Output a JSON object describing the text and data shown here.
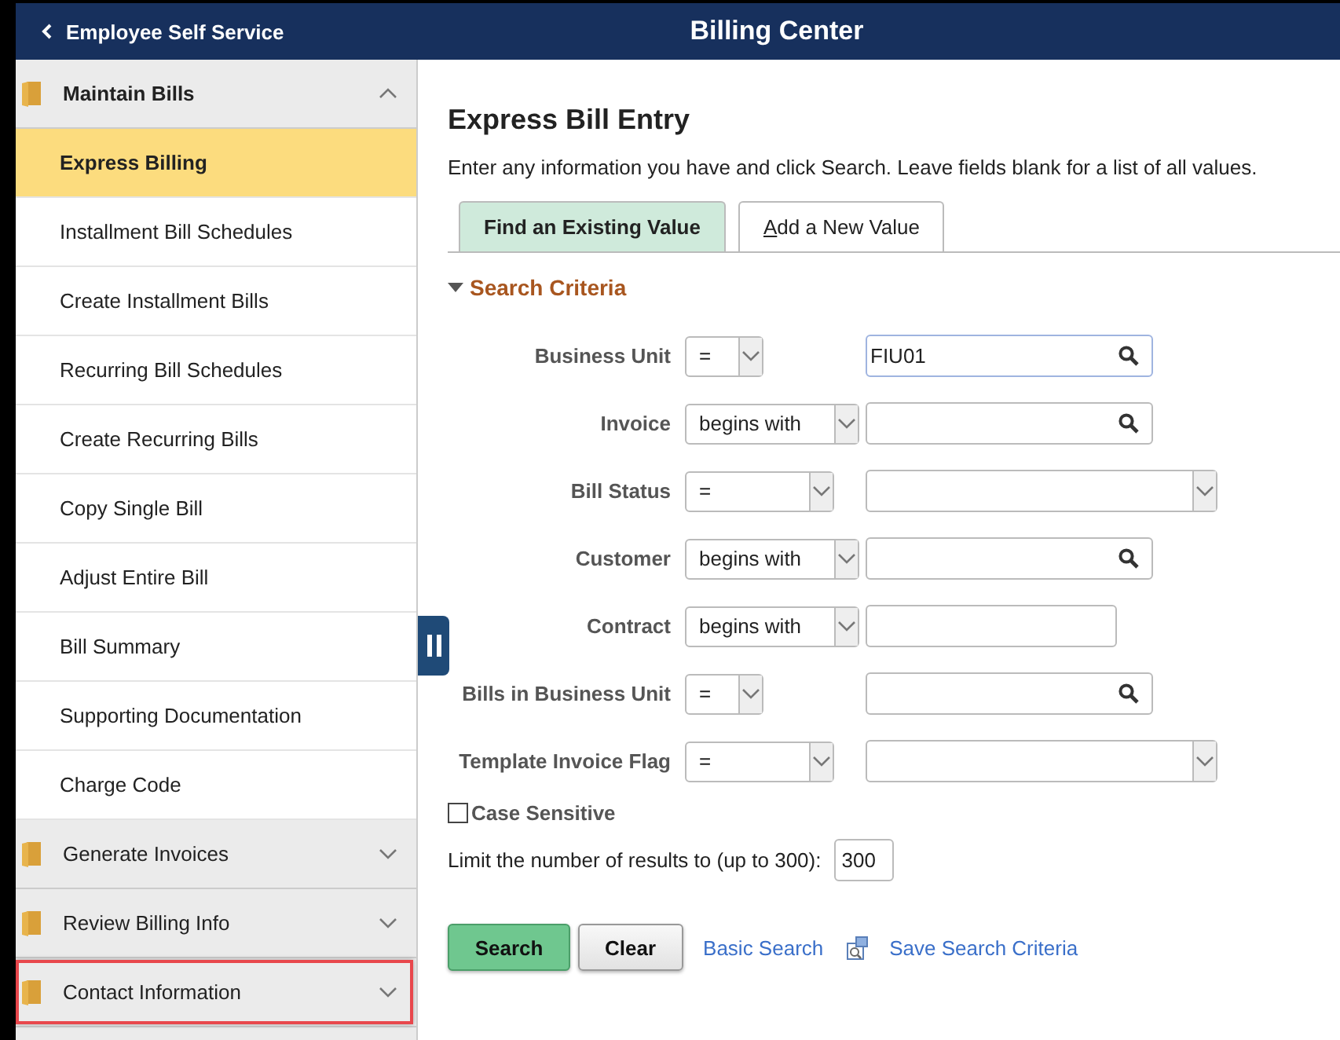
{
  "header": {
    "back_label": "Employee Self Service",
    "title": "Billing Center"
  },
  "sidebar": {
    "groups": [
      {
        "label": "Maintain Bills",
        "expanded": true,
        "highlighted": false,
        "items": [
          {
            "label": "Express Billing",
            "selected": true
          },
          {
            "label": "Installment Bill Schedules",
            "selected": false
          },
          {
            "label": "Create Installment Bills",
            "selected": false
          },
          {
            "label": "Recurring Bill Schedules",
            "selected": false
          },
          {
            "label": "Create Recurring Bills",
            "selected": false
          },
          {
            "label": "Copy Single Bill",
            "selected": false
          },
          {
            "label": "Adjust Entire Bill",
            "selected": false
          },
          {
            "label": "Bill Summary",
            "selected": false
          },
          {
            "label": "Supporting Documentation",
            "selected": false
          },
          {
            "label": "Charge Code",
            "selected": false
          }
        ]
      },
      {
        "label": "Generate Invoices",
        "expanded": false,
        "highlighted": false
      },
      {
        "label": "Review Billing Info",
        "expanded": false,
        "highlighted": false
      },
      {
        "label": "Contact Information",
        "expanded": false,
        "highlighted": true
      }
    ]
  },
  "page": {
    "title": "Express Bill Entry",
    "instructions": "Enter any information you have and click Search. Leave fields blank for a list of all values.",
    "tabs": [
      {
        "label": "Find an Existing Value",
        "selected": true,
        "access_key": false
      },
      {
        "label": "Add a New Value",
        "selected": false,
        "access_key": true
      }
    ],
    "section": {
      "label": "Search Criteria",
      "expanded": true
    },
    "criteria": [
      {
        "label": "Business Unit",
        "operator": "=",
        "kind": "lookup",
        "value": "FIU01",
        "focused": true
      },
      {
        "label": "Invoice",
        "operator": "begins with",
        "kind": "lookup",
        "focused": false
      },
      {
        "label": "Bill Status",
        "operator": "=",
        "kind": "select",
        "focused": false
      },
      {
        "label": "Customer",
        "operator": "begins with",
        "kind": "lookup",
        "focused": false
      },
      {
        "label": "Contract",
        "operator": "begins with",
        "kind": "text",
        "focused": false
      },
      {
        "label": "Bills in Business Unit",
        "operator": "=",
        "kind": "lookup",
        "focused": false
      },
      {
        "label": "Template Invoice Flag",
        "operator": "=",
        "kind": "select",
        "focused": false
      }
    ],
    "case_sensitive": {
      "label": "Case Sensitive",
      "checked": false
    },
    "limit": {
      "label": "Limit the number of results to (up to 300):",
      "value": "300"
    },
    "buttons": [
      {
        "label": "Search",
        "kind": "primary"
      },
      {
        "label": "Clear",
        "kind": "default"
      }
    ],
    "links": [
      {
        "label": "Basic Search",
        "icon": false
      },
      {
        "label": "Save Search Criteria",
        "icon": true
      }
    ]
  }
}
